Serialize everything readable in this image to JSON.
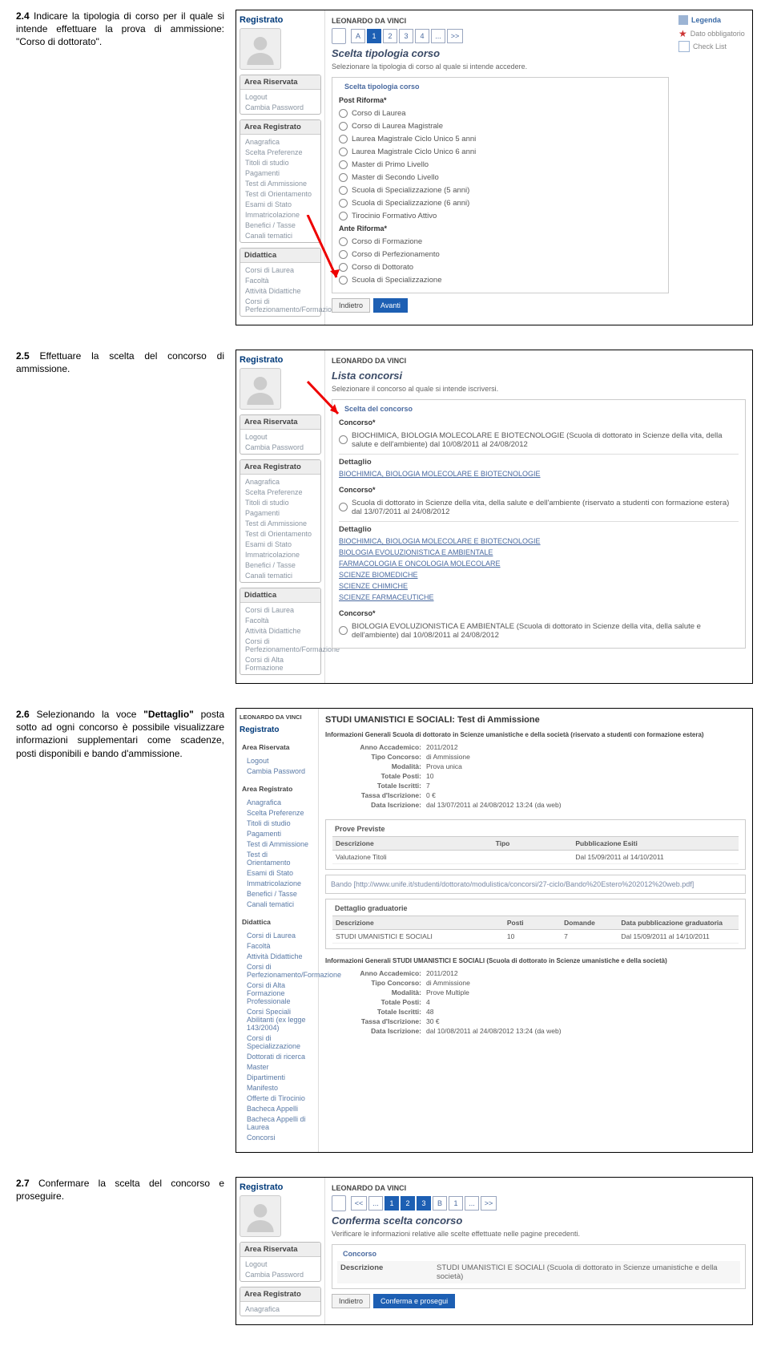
{
  "step24": {
    "instr_num": "2.4",
    "instr_txt": "Indicare la tipologia di corso per il quale si intende effettuare la prova di ammissione: \"Corso di dottorato\".",
    "registrato": "Registrato",
    "user": "LEONARDO DA VINCI",
    "boxes": {
      "riservata": {
        "h": "Area Riservata",
        "items": [
          "Logout",
          "Cambia Password"
        ]
      },
      "registrato": {
        "h": "Area Registrato",
        "items": [
          "Anagrafica",
          "Scelta Preferenze",
          "Titoli di studio",
          "Pagamenti",
          "Test di Ammissione",
          "Test di Orientamento",
          "Esami di Stato",
          "Immatricolazione",
          "Benefici / Tasse",
          "Canali tematici"
        ]
      },
      "didattica": {
        "h": "Didattica",
        "items": [
          "Corsi di Laurea",
          "Facoltà",
          "Attività Didattiche",
          "Corsi di Perfezionamento/Formazione"
        ]
      }
    },
    "stepper": {
      "a": "A",
      "s1": "1",
      "s2": "2",
      "s3": "3",
      "s4": "4",
      "dots": "...",
      "fwd": ">>"
    },
    "h1": "Scelta tipologia corso",
    "sub": "Selezionare la tipologia di corso al quale si intende accedere.",
    "legend_t": "Scelta tipologia corso",
    "post": "Post Riforma*",
    "opts_post": [
      "Corso di Laurea",
      "Corso di Laurea Magistrale",
      "Laurea Magistrale Ciclo Unico 5 anni",
      "Laurea Magistrale Ciclo Unico 6 anni",
      "Master di Primo Livello",
      "Master di Secondo Livello",
      "Scuola di Specializzazione (5 anni)",
      "Scuola di Specializzazione (6 anni)",
      "Tirocinio Formativo Attivo"
    ],
    "ante": "Ante Riforma*",
    "opts_ante": [
      "Corso di Formazione",
      "Corso di Perfezionamento",
      "Corso di Dottorato",
      "Scuola di Specializzazione"
    ],
    "btn_back": "Indietro",
    "btn_fwd": "Avanti",
    "right": {
      "h": "Legenda",
      "mand": "Dato obbligatorio",
      "chk": "Check List"
    }
  },
  "step25": {
    "instr_num": "2.5",
    "instr_txt": "Effettuare la scelta del concorso di ammissione.",
    "registrato": "Registrato",
    "user": "LEONARDO DA VINCI",
    "boxes": {
      "riservata": {
        "h": "Area Riservata",
        "items": [
          "Logout",
          "Cambia Password"
        ]
      },
      "registrato": {
        "h": "Area Registrato",
        "items": [
          "Anagrafica",
          "Scelta Preferenze",
          "Titoli di studio",
          "Pagamenti",
          "Test di Ammissione",
          "Test di Orientamento",
          "Esami di Stato",
          "Immatricolazione",
          "Benefici / Tasse",
          "Canali tematici"
        ]
      },
      "didattica": {
        "h": "Didattica",
        "items": [
          "Corsi di Laurea",
          "Facoltà",
          "Attività Didattiche",
          "Corsi di Perfezionamento/Formazione",
          "Corsi di Alta Formazione"
        ]
      }
    },
    "h1": "Lista concorsi",
    "sub": "Selezionare il concorso al quale si intende iscriversi.",
    "legend_t": "Scelta del concorso",
    "conc_l": "Concorso*",
    "opt1": "BIOCHIMICA, BIOLOGIA MOLECOLARE E BIOTECNOLOGIE (Scuola di dottorato in Scienze della vita, della salute e dell'ambiente) dal 10/08/2011 al 24/08/2012",
    "dett_h": "Dettaglio",
    "dett1": "BIOCHIMICA, BIOLOGIA MOLECOLARE E BIOTECNOLOGIE",
    "opt2": "Scuola di dottorato in Scienze della vita, della salute e dell'ambiente (riservato a studenti con formazione estera) dal 13/07/2011 al 24/08/2012",
    "dett_list": [
      "BIOCHIMICA, BIOLOGIA MOLECOLARE E BIOTECNOLOGIE",
      "BIOLOGIA EVOLUZIONISTICA E AMBIENTALE",
      "FARMACOLOGIA E ONCOLOGIA MOLECOLARE",
      "SCIENZE BIOMEDICHE",
      "SCIENZE CHIMICHE",
      "SCIENZE FARMACEUTICHE"
    ],
    "opt3": "BIOLOGIA EVOLUZIONISTICA E AMBIENTALE (Scuola di dottorato in Scienze della vita, della salute e dell'ambiente) dal 10/08/2011 al 24/08/2012"
  },
  "step26": {
    "instr_num": "2.6",
    "instr_txt_a": "Selezionando la voce ",
    "instr_det": "\"Dettaglio\"",
    "instr_txt_b": " posta sotto ad ogni concorso è possibile visualizzare informazioni supplementari come scadenze, posti disponibili e bando d'ammissione.",
    "user": "LEONARDO DA VINCI",
    "registrato": "Registrato",
    "boxes": {
      "riservata": {
        "h": "Area Riservata",
        "items": [
          "Logout",
          "Cambia Password"
        ]
      },
      "registrato": {
        "h": "Area Registrato",
        "items": [
          "Anagrafica",
          "Scelta Preferenze",
          "Titoli di studio",
          "Pagamenti",
          "Test di Ammissione",
          "Test di Orientamento",
          "Esami di Stato",
          "Immatricolazione",
          "Benefici / Tasse",
          "Canali tematici"
        ]
      },
      "didattica": {
        "h": "Didattica",
        "items_full": [
          "Corsi di Laurea",
          "Facoltà",
          "Attività Didattiche",
          "Corsi di Perfezionamento/Formazione",
          "Corsi di Alta Formazione Professionale",
          "Corsi Speciali Abilitanti (ex legge 143/2004)",
          "Corsi di Specializzazione",
          "Dottorati di ricerca",
          "Master",
          "Dipartimenti",
          "Manifesto",
          "Offerte di Tirocinio",
          "Bacheca Appelli",
          "Bacheca Appelli di Laurea",
          "Concorsi"
        ]
      }
    },
    "h1": "STUDI UMANISTICI E SOCIALI: Test di Ammissione",
    "info_line": "Informazioni Generali   Scuola di dottorato in Scienze umanistiche e della società (riservato a studenti con formazione estera)",
    "kv1": {
      "aa_k": "Anno Accademico:",
      "aa_v": "2011/2012",
      "tc_k": "Tipo Concorso:",
      "tc_v": "di Ammissione",
      "mod_k": "Modalità:",
      "mod_v": "Prova unica",
      "tp_k": "Totale Posti:",
      "tp_v": "10",
      "ti_k": "Totale Iscritti:",
      "ti_v": "7",
      "tas_k": "Tassa d'Iscrizione:",
      "tas_v": "0 €",
      "dat_k": "Data Iscrizione:",
      "dat_v": "dal 13/07/2011 al 24/08/2012 13:24 (da web)"
    },
    "prove_h": "Prove Previste",
    "prove_th": {
      "c1": "Descrizione",
      "c2": "Tipo",
      "c3": "Pubblicazione Esiti"
    },
    "prove_r": {
      "c1": "Valutazione Titoli",
      "c3": "Dal 15/09/2011 al 14/10/2011"
    },
    "bando": "Bando [http://www.unife.it/studenti/dottorato/modulistica/concorsi/27-ciclo/Bando%20Estero%202012%20web.pdf]",
    "grad_h": "Dettaglio graduatorie",
    "grad_th": {
      "c1": "Descrizione",
      "c2": "Posti",
      "c3": "Domande",
      "c4": "Data pubblicazione graduatoria"
    },
    "grad_r": {
      "c1": "STUDI UMANISTICI E SOCIALI",
      "c2": "10",
      "c3": "7",
      "c4": "Dal 15/09/2011 al 14/10/2011"
    },
    "info2": "Informazioni Generali   STUDI UMANISTICI E SOCIALI (Scuola di dottorato in Scienze umanistiche e della società)",
    "kv2": {
      "aa_k": "Anno Accademico:",
      "aa_v": "2011/2012",
      "tc_k": "Tipo Concorso:",
      "tc_v": "di Ammissione",
      "mod_k": "Modalità:",
      "mod_v": "Prove Multiple",
      "tp_k": "Totale Posti:",
      "tp_v": "4",
      "ti_k": "Totale Iscritti:",
      "ti_v": "48",
      "tas_k": "Tassa d'Iscrizione:",
      "tas_v": "30 €",
      "dat_k": "Data Iscrizione:",
      "dat_v": "dal 10/08/2011 al 24/08/2012 13:24 (da web)"
    }
  },
  "step27": {
    "instr_num": "2.7",
    "instr_txt": "Confermare la scelta del concorso e proseguire.",
    "registrato": "Registrato",
    "user": "LEONARDO DA VINCI",
    "boxes": {
      "riservata": {
        "h": "Area Riservata",
        "items": [
          "Logout",
          "Cambia Password"
        ]
      },
      "registrato": {
        "h": "Area Registrato",
        "items": [
          "Anagrafica"
        ]
      }
    },
    "stepper": {
      "bk": "<<",
      "dots": "...",
      "s1": "1",
      "s2": "2",
      "s3": "3",
      "b": "B",
      "s1b": "1",
      "fwd": ">>"
    },
    "h1": "Conferma scelta concorso",
    "sub": "Verificare le informazioni relative alle scelte effettuate nelle pagine precedenti.",
    "conc_h": "Concorso",
    "desc_k": "Descrizione",
    "desc_v": "STUDI UMANISTICI E SOCIALI (Scuola di dottorato in Scienze umanistiche e della società)",
    "btn_back": "Indietro",
    "btn_fwd": "Conferma e prosegui"
  }
}
